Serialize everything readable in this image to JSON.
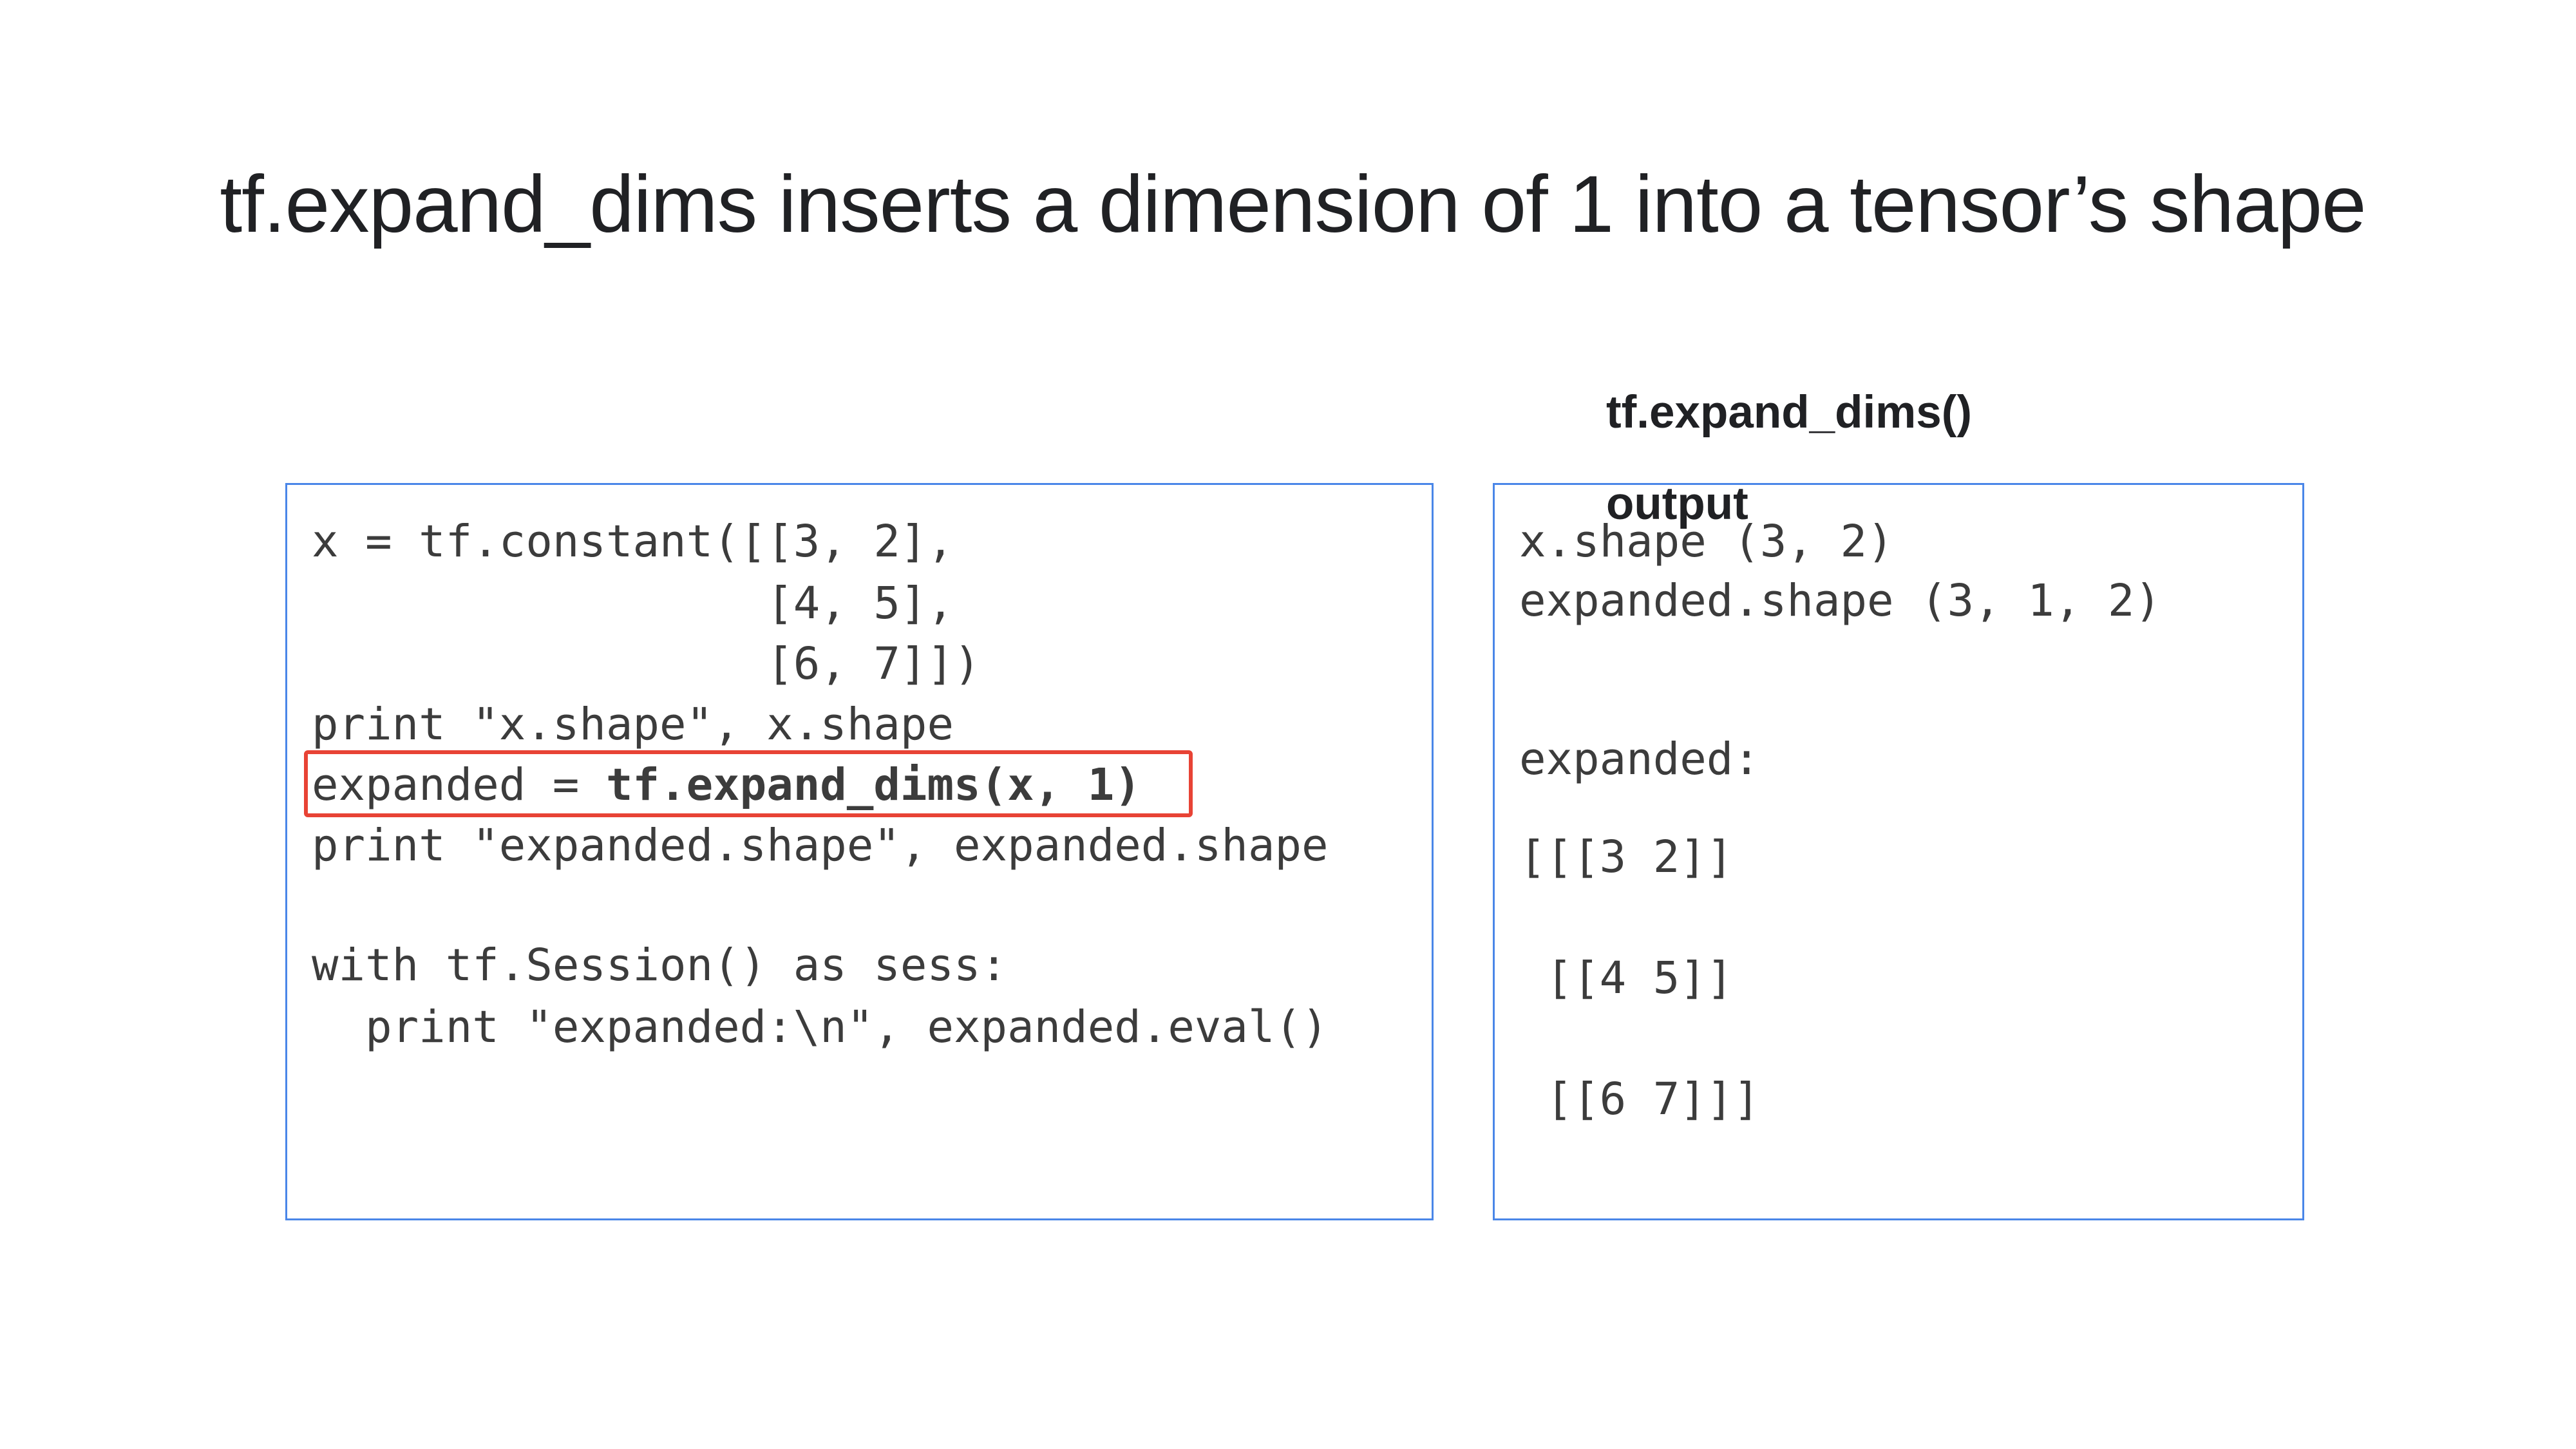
{
  "slide": {
    "title": "tf.expand_dims inserts a dimension of 1 into a tensor’s shape",
    "output_heading_line1": "tf.expand_dims()",
    "output_heading_line2": "output"
  },
  "code": {
    "lines": [
      "x = tf.constant([[3, 2],",
      "                 [4, 5],",
      "                 [6, 7]])",
      "print \"x.shape\", x.shape",
      "",
      "print \"expanded.shape\", expanded.shape",
      "",
      "with tf.Session() as sess:",
      "  print \"expanded:\\n\", expanded.eval()"
    ],
    "highlighted_prefix": "expanded = ",
    "highlighted_bold": "tf.expand_dims(x, 1)"
  },
  "output": {
    "lines": [
      "x.shape (3, 2)",
      "expanded.shape (3, 1, 2)",
      "expanded:",
      "[[[3 2]]",
      " [[4 5]]",
      " [[6 7]]]"
    ]
  },
  "colors": {
    "panel_border": "#4a86e8",
    "highlight_border": "#e84335",
    "text": "#202124",
    "code_text": "#3c3c3c"
  }
}
